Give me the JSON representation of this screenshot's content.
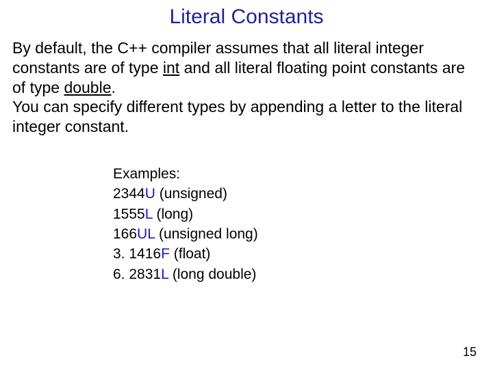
{
  "title": "Literal Constants",
  "para1a": "By default, the C++ compiler assumes that all literal integer constants are of type ",
  "kw_int": "int",
  "para1b": " and all literal floating point constants are of type ",
  "kw_double": "double",
  "para1c": ".",
  "para2": "You can specify different types by appending a letter to the literal integer constant.",
  "ex_heading": "Examples:",
  "examples": [
    {
      "num": "2344",
      "suf": "U",
      "desc": "  (unsigned)"
    },
    {
      "num": "1555",
      "suf": "L",
      "desc": "  (long)"
    },
    {
      "num": "166",
      "suf": "UL",
      "desc": " (unsigned long)"
    },
    {
      "num": "3. 1416",
      "suf": "F",
      "desc": " (float)"
    },
    {
      "num": "6. 2831",
      "suf": "L",
      "desc": " (long double)"
    }
  ],
  "page_number": "15"
}
